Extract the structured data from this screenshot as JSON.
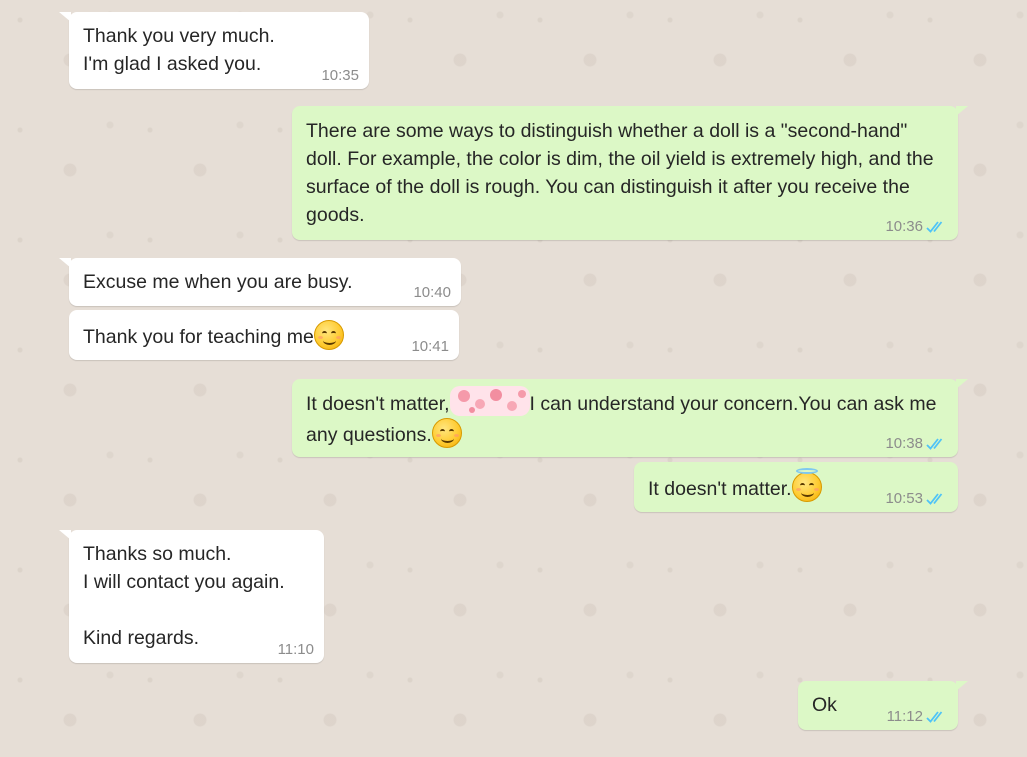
{
  "theme": {
    "incoming_bg": "#ffffff",
    "outgoing_bg": "#dcf8c6",
    "tick_color": "#4fc3f7"
  },
  "messages": [
    {
      "dir": "in",
      "text": "Thank you very much.\nI'm glad I asked you.",
      "time": "10:35"
    },
    {
      "dir": "out",
      "text": "There are some ways to distinguish whether a doll is a \"second-hand\" doll. For example, the color is dim, the oil yield is extremely high, and the surface of the doll is rough. You can distinguish it after you receive the goods.",
      "time": "10:36",
      "status": "read"
    },
    {
      "dir": "in",
      "text": "Excuse me when you are busy.",
      "time": "10:40"
    },
    {
      "dir": "in",
      "text": "Thank you for teaching me",
      "emoji": "smiling-face-icon",
      "time": "10:41"
    },
    {
      "dir": "out",
      "text_a": "It doesn't matter,",
      "sticker": "pink-hearts-sticker",
      "text_b": "I can understand your concern.You can ask me any questions.",
      "emoji": "smiling-face-icon",
      "time": "10:38",
      "status": "read"
    },
    {
      "dir": "out",
      "text": "It doesn't matter.",
      "emoji": "halo-face-icon",
      "time": "10:53",
      "status": "read"
    },
    {
      "dir": "in",
      "text": "Thanks so much.\nI will contact you again.\n\nKind regards.",
      "time": "11:10"
    },
    {
      "dir": "out",
      "text": "Ok",
      "time": "11:12",
      "status": "read"
    }
  ]
}
